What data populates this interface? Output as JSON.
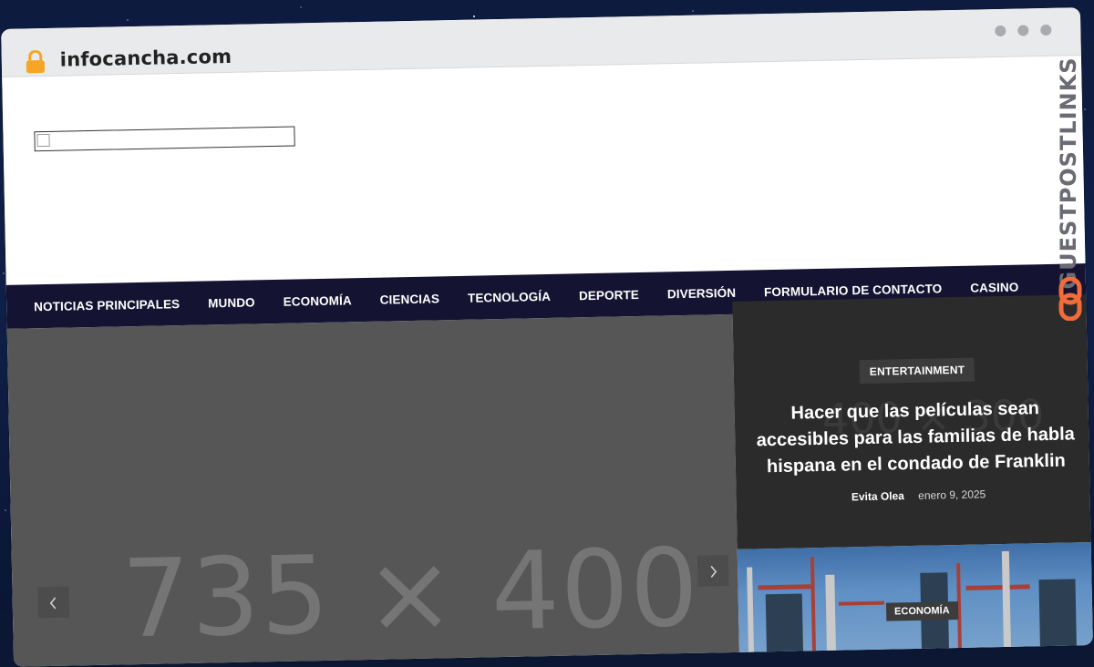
{
  "browser": {
    "url": "infocancha.com"
  },
  "nav": {
    "items": [
      "NOTICIAS PRINCIPALES",
      "MUNDO",
      "ECONOMÍA",
      "CIENCIAS",
      "TECNOLOGÍA",
      "DEPORTE",
      "DIVERSIÓN",
      "FORMULARIO DE CONTACTO",
      "CASINO"
    ]
  },
  "slider": {
    "placeholder": "735 × 400",
    "prev_icon": "chevron-left-icon",
    "next_icon": "chevron-right-icon"
  },
  "featured": {
    "ghost": "400 × 300",
    "category": "ENTERTAINMENT",
    "title": "Hacer que las películas sean accesibles para las familias de habla hispana en el condado de Franklin",
    "author": "Evita Olea",
    "date": "enero 9, 2025"
  },
  "second_post": {
    "category": "ECONOMÍA"
  },
  "watermark": {
    "text": "GUESTPOSTLINKS"
  },
  "colors": {
    "nav_bg": "#141331",
    "slider_bg": "#565656",
    "featured_bg": "#2b2b2b",
    "lock": "#f5a623",
    "watermark_accent": "#f26b3a"
  }
}
